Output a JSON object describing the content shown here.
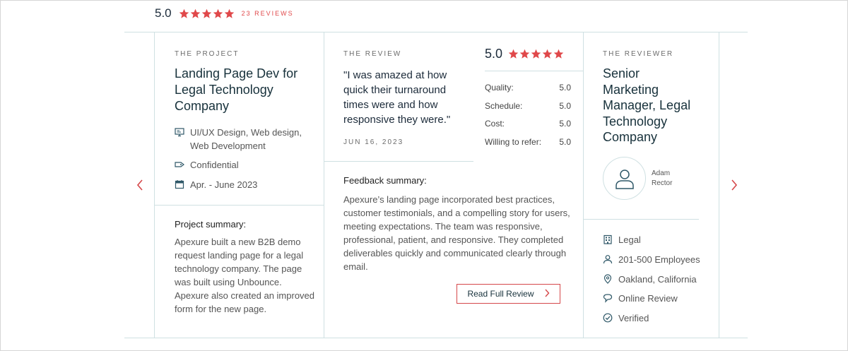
{
  "header": {
    "score": "5.0",
    "reviews_label": "23 REVIEWS",
    "star_count": 5,
    "star_color": "#e0484a"
  },
  "project": {
    "eyebrow": "THE PROJECT",
    "title_lines": [
      "Landing Page Dev for",
      "Legal Technology",
      "Company"
    ],
    "services_line1": "UI/UX Design, Web design,",
    "services_line2": "Web Development",
    "budget": "Confidential",
    "dates": "Apr. - June 2023",
    "summary_heading": "Project summary:",
    "summary_lines": [
      "Apexure built a new B2B demo",
      "request landing page for a legal",
      "technology company. The page",
      "was built using Unbounce.",
      "Apexure also created an improved",
      "form for the new page."
    ],
    "icons": [
      "monitor-icon",
      "tag-icon",
      "calendar-icon"
    ]
  },
  "review": {
    "eyebrow": "THE REVIEW",
    "quote_lines": [
      "\"I was amazed at how",
      "quick their turnaround",
      "times were and how",
      "responsive they were.\""
    ],
    "date": "JUN 16, 2023",
    "feedback_heading": "Feedback summary:",
    "feedback_lines": [
      "Apexure’s landing page incorporated best practices,",
      "customer testimonials, and a compelling story for users,",
      "meeting expectations. The team was responsive,",
      "professional, patient, and responsive. They completed",
      "deliverables quickly and communicated clearly through",
      "email."
    ],
    "read_full_label": "Read Full Review"
  },
  "ratings": {
    "overall": "5.0",
    "rows": [
      {
        "label": "Quality:",
        "value": "5.0"
      },
      {
        "label": "Schedule:",
        "value": "5.0"
      },
      {
        "label": "Cost:",
        "value": "5.0"
      },
      {
        "label": "Willing to refer:",
        "value": "5.0"
      }
    ]
  },
  "reviewer": {
    "eyebrow": "THE REVIEWER",
    "title_lines": [
      "Senior",
      "Marketing",
      "Manager, Legal",
      "Technology",
      "Company"
    ],
    "name_line1": "Adam",
    "name_line2": "Rector",
    "industry": "Legal",
    "size": "201-500 Employees",
    "location": "Oakland, California",
    "review_type": "Online Review",
    "status": "Verified",
    "icons": [
      "building-icon",
      "person-icon",
      "location-pin-icon",
      "chat-bubble-icon",
      "check-circle-icon"
    ]
  },
  "nav": {
    "prev_icon": "chevron-left-icon",
    "next_icon": "chevron-right-icon",
    "accent": "#d5484a"
  }
}
